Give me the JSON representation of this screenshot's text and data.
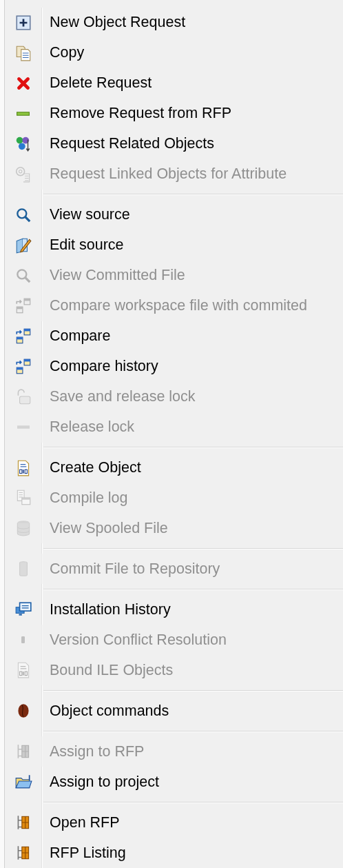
{
  "menu": {
    "groups": [
      {
        "items": [
          {
            "label": "New Object Request",
            "disabled": false
          },
          {
            "label": "Copy",
            "disabled": false
          },
          {
            "label": "Delete Request",
            "disabled": false
          },
          {
            "label": "Remove Request from RFP",
            "disabled": false
          },
          {
            "label": "Request Related Objects",
            "disabled": false
          },
          {
            "label": "Request Linked Objects for Attribute",
            "disabled": true
          }
        ]
      },
      {
        "items": [
          {
            "label": "View source",
            "disabled": false
          },
          {
            "label": "Edit source",
            "disabled": false
          },
          {
            "label": "View Committed File",
            "disabled": true
          },
          {
            "label": "Compare workspace file with commited",
            "disabled": true
          },
          {
            "label": "Compare",
            "disabled": false
          },
          {
            "label": "Compare history",
            "disabled": false
          },
          {
            "label": "Save and release lock",
            "disabled": true
          },
          {
            "label": "Release lock",
            "disabled": true
          }
        ]
      },
      {
        "items": [
          {
            "label": "Create Object",
            "disabled": false
          },
          {
            "label": "Compile log",
            "disabled": true
          },
          {
            "label": "View Spooled File",
            "disabled": true
          }
        ]
      },
      {
        "items": [
          {
            "label": "Commit File to Repository",
            "disabled": true
          }
        ]
      },
      {
        "items": [
          {
            "label": "Installation History",
            "disabled": false
          },
          {
            "label": "Version Conflict Resolution",
            "disabled": true
          },
          {
            "label": "Bound ILE Objects",
            "disabled": true
          }
        ]
      },
      {
        "items": [
          {
            "label": "Object commands",
            "disabled": false
          }
        ]
      },
      {
        "items": [
          {
            "label": "Assign to RFP",
            "disabled": true
          },
          {
            "label": "Assign to project",
            "disabled": false
          }
        ]
      },
      {
        "items": [
          {
            "label": "Open RFP",
            "disabled": false
          },
          {
            "label": "RFP Listing",
            "disabled": false
          }
        ]
      }
    ]
  }
}
